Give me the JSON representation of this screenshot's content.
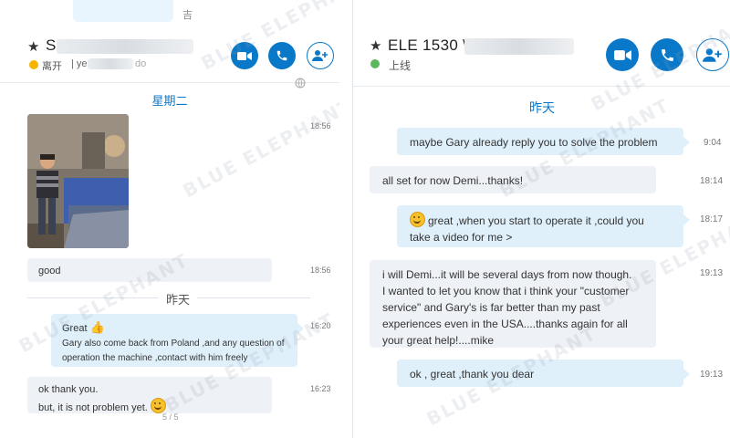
{
  "left": {
    "top_fragment": "吉",
    "contact_name_visible": "S",
    "status_text": "离开",
    "status_suffix": "| ye",
    "status_tail": "do",
    "status_color": "#f4b400",
    "day_label": "星期二",
    "day_label_2": "昨天",
    "messages": [
      {
        "kind": "image",
        "alt": "photo of man with CNC machine",
        "time": "18:56"
      },
      {
        "kind": "in",
        "text": "good",
        "time": "18:56"
      },
      {
        "kind": "out",
        "title": "Great",
        "text": "Gary also come back from Poland ,and any question of operation the machine ,contact with him freely",
        "time": "16:20"
      },
      {
        "kind": "in",
        "line1": "ok thank you.",
        "line2": "but, it is not problem yet.",
        "time": "16:23"
      }
    ],
    "bottom_fragment": "5 / 5"
  },
  "right": {
    "contact_name": "ELE 1530 \\",
    "status_text": "上线",
    "status_color": "#5cb85c",
    "day_label": "昨天",
    "messages": [
      {
        "kind": "out",
        "text": "maybe Gary already reply you to solve the problem",
        "time": "9:04"
      },
      {
        "kind": "in",
        "text": "all set for now  Demi...thanks!",
        "time": "18:14"
      },
      {
        "kind": "out",
        "line1": "great ,when you start to operate it ,could you",
        "line2": "take a video for me >",
        "time": "18:17"
      },
      {
        "kind": "in",
        "line1": "i will Demi...it will be several days from now though.",
        "line2": "I wanted to let you know that i think your \"customer",
        "line3": "service\" and Gary's is far better than my past",
        "line4": "experiences even in the USA....thanks again for all",
        "line5": "your great help!....mike",
        "time": "19:13"
      },
      {
        "kind": "out",
        "text": "ok ,  great ,thank you dear",
        "time": "19:13"
      }
    ]
  },
  "watermark": "BLUE ELEPHANT",
  "colors": {
    "accent": "#0a78c8",
    "bubble_out": "#dff0fb",
    "bubble_in": "#eef1f5"
  }
}
